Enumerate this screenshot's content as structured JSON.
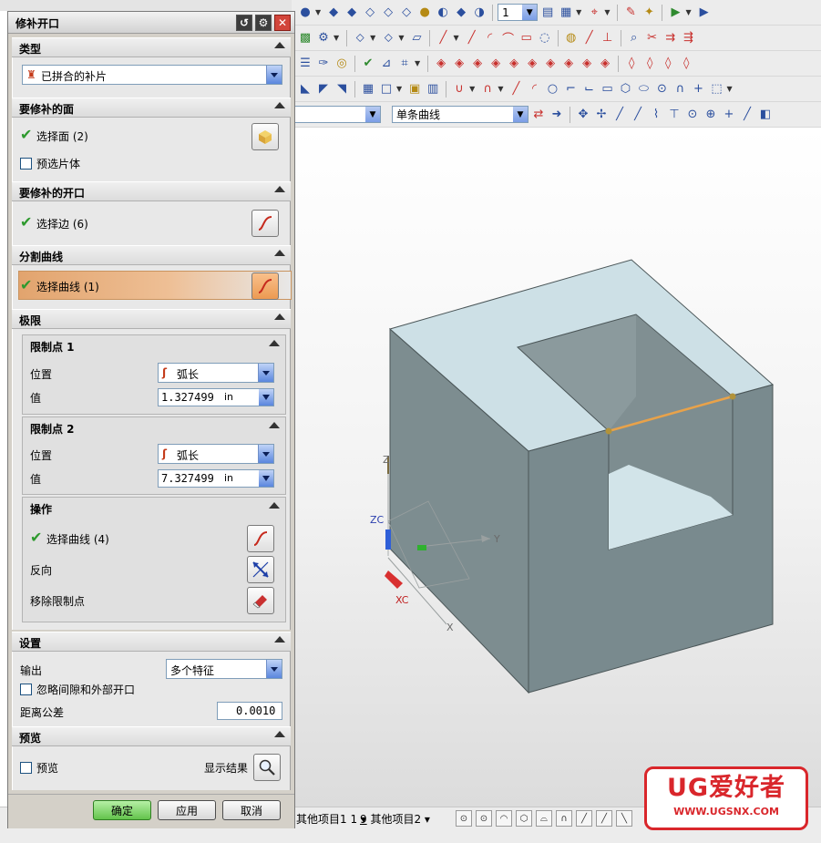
{
  "dialog": {
    "title": "修补开口",
    "sections": {
      "type": {
        "label": "类型",
        "value": "已拼合的补片"
      },
      "faces": {
        "label": "要修补的面",
        "select": "选择面 (2)",
        "preview_sheet": "预选片体"
      },
      "opening": {
        "label": "要修补的开口",
        "select": "选择边 (6)"
      },
      "split_curve": {
        "label": "分割曲线",
        "select": "选择曲线 (1)"
      },
      "limits": {
        "label": "极限",
        "limit1": {
          "label": "限制点 1",
          "position_label": "位置",
          "position_value": "弧长",
          "value_label": "值",
          "value": "1.327499",
          "unit": "in"
        },
        "limit2": {
          "label": "限制点 2",
          "position_label": "位置",
          "position_value": "弧长",
          "value_label": "值",
          "value": "7.327499",
          "unit": "in"
        },
        "operation": {
          "label": "操作",
          "select": "选择曲线 (4)",
          "reverse": "反向",
          "remove": "移除限制点"
        }
      },
      "settings": {
        "label": "设置",
        "output_label": "输出",
        "output_value": "多个特征",
        "ignore_gaps": "忽略间隙和外部开口",
        "tolerance_label": "距离公差",
        "tolerance_value": "0.0010"
      },
      "preview": {
        "label": "预览",
        "preview_check": "预览",
        "show_result": "显示结果"
      }
    },
    "buttons": {
      "ok": "确定",
      "apply": "应用",
      "cancel": "取消"
    }
  },
  "toolbar": {
    "layer_value": "1",
    "curve_rule": "单条曲线"
  },
  "viewport": {
    "axis_labels": {
      "zc": "ZC",
      "xc": "XC",
      "y": "Y",
      "z": "Z",
      "x": "X"
    }
  },
  "statusbar": {
    "misc1_num": "1",
    "misc1": "其他项目1",
    "misc2_num": "9",
    "misc2": "其他项目2"
  },
  "watermark": {
    "main": "UG爱好者",
    "url": "WWW.UGSNX.COM"
  },
  "colors": {
    "accent_orange": "#e2a46e",
    "face_light": "#cde0e6",
    "face_dark": "#7d8d90",
    "curve": "#e8a24a"
  }
}
